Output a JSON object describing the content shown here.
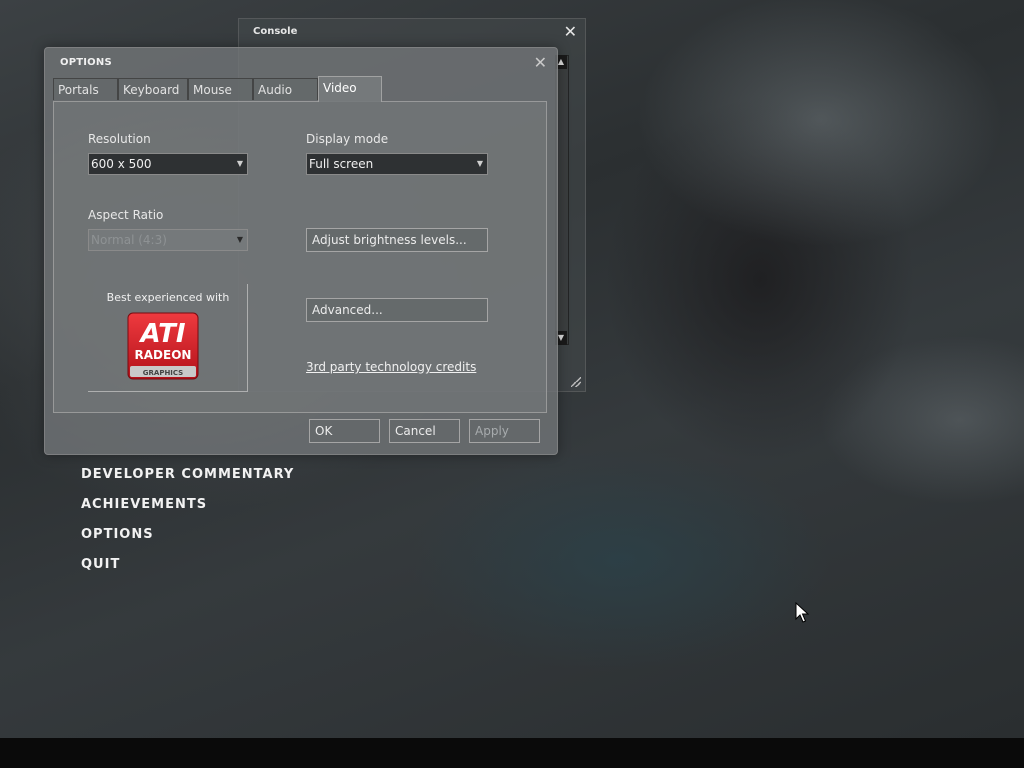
{
  "console": {
    "title": "Console",
    "close_glyph": "✕",
    "scroll_up_glyph": "▲",
    "scroll_down_glyph": "▼"
  },
  "options": {
    "title": "OPTIONS",
    "close_glyph": "✕",
    "tabs": [
      {
        "label": "Portals",
        "active": false
      },
      {
        "label": "Keyboard",
        "active": false
      },
      {
        "label": "Mouse",
        "active": false
      },
      {
        "label": "Audio",
        "active": false
      },
      {
        "label": "Video",
        "active": true
      }
    ],
    "video": {
      "resolution_label": "Resolution",
      "resolution_value": "600 x 500",
      "display_mode_label": "Display mode",
      "display_mode_value": "Full screen",
      "aspect_ratio_label": "Aspect Ratio",
      "aspect_ratio_value": "Normal (4:3)",
      "aspect_ratio_enabled": false,
      "brightness_button": "Adjust brightness levels...",
      "advanced_button": "Advanced...",
      "credits_link": "3rd party technology credits",
      "sponsor_caption": "Best experienced with",
      "sponsor_logo": {
        "brand": "ATI",
        "line2": "RADEON",
        "line3": "GRAPHICS",
        "color": "#d81e25"
      }
    },
    "buttons": {
      "ok": "OK",
      "cancel": "Cancel",
      "apply": "Apply",
      "apply_enabled": false
    },
    "dropdown_arrow_glyph": "▼"
  },
  "main_menu": {
    "items": [
      "DEVELOPER COMMENTARY",
      "ACHIEVEMENTS",
      "OPTIONS",
      "QUIT"
    ]
  }
}
